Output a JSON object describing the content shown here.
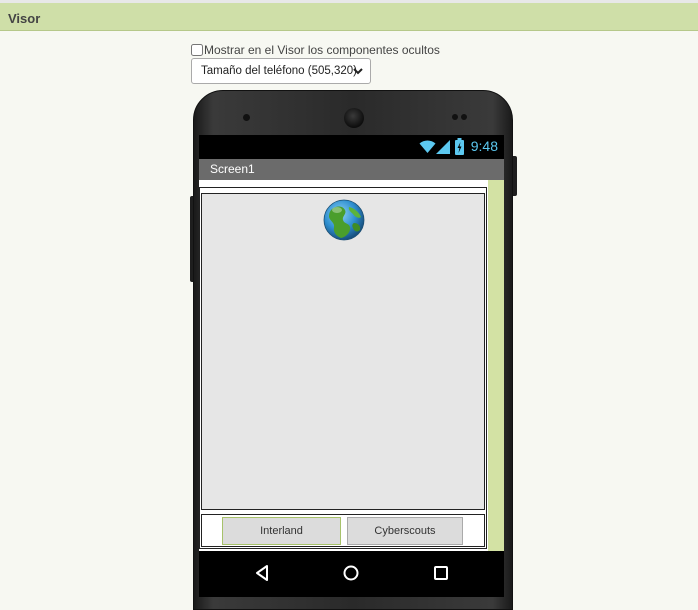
{
  "header": {
    "title": "Visor"
  },
  "options": {
    "show_hidden_label": "Mostrar en el Visor los componentes ocultos",
    "phone_size_selected": "Tamaño del teléfono (505,320)"
  },
  "phone": {
    "status_time": "9:48",
    "screen_title": "Screen1",
    "buttons": [
      {
        "label": "Interland"
      },
      {
        "label": "Cyberscouts"
      }
    ]
  },
  "colors": {
    "header_bg": "#cfdfa8",
    "status_accent": "#5cc8f0",
    "titlebar": "#6b6b6b"
  },
  "icons": [
    "wifi-icon",
    "signal-icon",
    "battery-icon",
    "globe-icon",
    "back-icon",
    "home-icon",
    "recents-icon",
    "chevron-down-icon"
  ]
}
